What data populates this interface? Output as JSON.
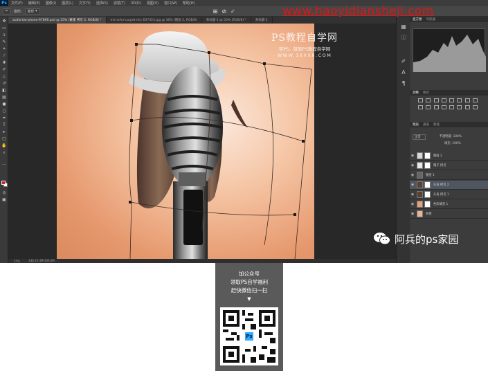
{
  "app": {
    "logo": "Ps",
    "menu": [
      "文件(F)",
      "编辑(E)",
      "图像(I)",
      "图层(L)",
      "文字(Y)",
      "选择(S)",
      "滤镜(T)",
      "3D(D)",
      "视图(V)",
      "窗口(W)",
      "帮助(H)"
    ],
    "options": {
      "mode": "变形",
      "icons": [
        "grid-icon",
        "cancel-icon",
        "commit-icon"
      ]
    },
    "tabs": [
      {
        "label": "audio-bw-phone-67890.psd @ 25% (蒙版 拷贝 2, RGB/8) *",
        "active": true
      },
      {
        "label": "mirrorfor-carpet-mic-657453.jpg @ 36% (图层 2, RGB/8)",
        "active": false
      },
      {
        "label": "未标题-1 @ 50% (RGB/8) *",
        "active": false
      },
      {
        "label": "未标题-1",
        "active": false
      }
    ],
    "status": [
      "25%",
      "文档:16.4M/106.6M"
    ]
  },
  "watermark": {
    "title": "PS教程自学网",
    "subtitle": "学PS，就到PS教程自学网",
    "site": "WWW.16XX8.COM"
  },
  "red_url": "www.haoyidiansheji.com",
  "panels": {
    "tabs_top": [
      "直方图",
      "导航器"
    ],
    "tabs_mid": [
      "调整",
      "样式"
    ],
    "tabs_layers": [
      "图层",
      "通道",
      "路径"
    ],
    "blend_mode": "正常",
    "opacity": "不透明度: 100%",
    "fill": "填充: 100%",
    "layers": [
      {
        "name": "图层 2",
        "selected": false,
        "thumb": "#d8d8d8",
        "mask": true
      },
      {
        "name": "帽子 拷贝",
        "selected": false,
        "thumb": "#e8e8e8",
        "mask": true
      },
      {
        "name": "图层 1",
        "selected": false,
        "thumb": "#666666",
        "mask": false
      },
      {
        "name": "头发 拷贝 2",
        "selected": true,
        "thumb": "#5a4030",
        "mask": true
      },
      {
        "name": "头发 拷贝 1",
        "selected": false,
        "thumb": "#5a4030",
        "mask": true
      },
      {
        "name": "色彩填充 1",
        "selected": false,
        "thumb": "#e5a27a",
        "mask": true
      },
      {
        "name": "背景",
        "selected": false,
        "thumb": "#e8b597",
        "mask": false
      }
    ]
  },
  "brand": "阿兵的ps家园",
  "qr": {
    "lines": [
      "加公众号",
      "领取PS自学福利",
      "赶快微信扫一扫"
    ],
    "arrow": "▼",
    "badge": "Ps"
  },
  "colors": {
    "ps_blue": "#31a8ff",
    "red_url": "#d61818",
    "foreground": "#d42121",
    "background": "#ffffff"
  }
}
